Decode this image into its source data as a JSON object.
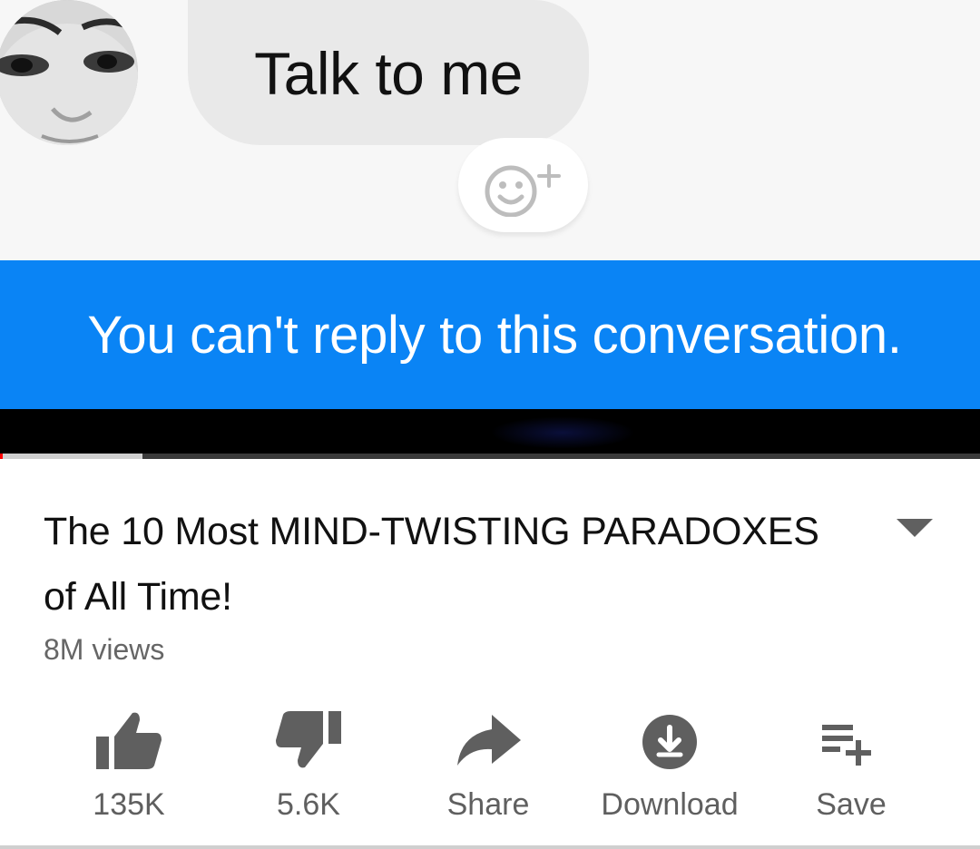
{
  "messenger": {
    "message_text": "Talk to me",
    "reaction_icon": "smiley-plus-icon",
    "notice": "You can't reply to this conversation.",
    "colors": {
      "banner": "#0a84f5",
      "bubble": "#e9e9e9"
    }
  },
  "video": {
    "progress": {
      "played_fraction": 0.003,
      "buffered_fraction": 0.145
    },
    "title": "The 10 Most MIND-TWISTING PARADOXES of All Time!",
    "views": "8M views",
    "actions": [
      {
        "icon": "thumbs-up-icon",
        "label": "135K"
      },
      {
        "icon": "thumbs-down-icon",
        "label": "5.6K"
      },
      {
        "icon": "share-icon",
        "label": "Share"
      },
      {
        "icon": "download-icon",
        "label": "Download"
      },
      {
        "icon": "save-playlist-icon",
        "label": "Save"
      }
    ]
  }
}
